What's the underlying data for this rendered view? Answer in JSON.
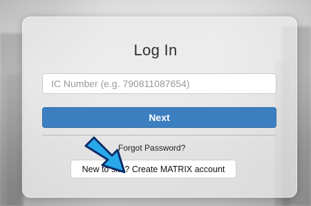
{
  "login": {
    "title": "Log In",
    "ic_input": {
      "placeholder": "IC Number (e.g. 790811087654)",
      "value": ""
    },
    "next_label": "Next",
    "forgot_password_label": "Forgot Password?",
    "create_account_label": "New to site? Create MATRIX account"
  },
  "colors": {
    "primary_button": "#3c7fc0",
    "annotation_arrow": "#28a8e8"
  },
  "icons": {
    "annotation": "blue-arrow-icon"
  }
}
